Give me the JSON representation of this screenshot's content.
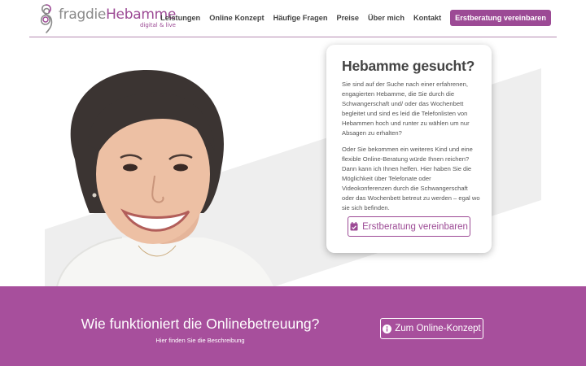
{
  "brand": {
    "name_light": "fragdie",
    "name_strong": "Hebamme",
    "tagline": "digital & live",
    "accent": "#9c4a95"
  },
  "nav": {
    "items": [
      {
        "label": "Leistungen"
      },
      {
        "label": "Online Konzept"
      },
      {
        "label": "Häufige Fragen"
      },
      {
        "label": "Preise"
      },
      {
        "label": "Über mich"
      },
      {
        "label": "Kontakt"
      }
    ],
    "cta_label": "Erstberatung vereinbaren"
  },
  "hero": {
    "title": "Hebamme gesucht?",
    "paragraph_1": "Sie sind auf der Suche nach einer erfahrenen, engagierten Hebamme, die Sie durch die Schwangerschaft und/ oder das Wochenbett begleitet und sind es leid die Telefonlisten von Hebammen hoch und runter zu wählen um nur Absagen zu erhalten?",
    "paragraph_2": "Oder Sie bekommen ein weiteres Kind und eine flexible Online-Beratung würde Ihnen reichen? Dann kann ich Ihnen helfen. Hier haben Sie die Möglichkeit über Telefonate oder Videokonferenzen durch die Schwangerschaft oder das Wochenbett betreut zu werden – egal wo sie sich befinden.",
    "button_label": "Erstberatung vereinbaren",
    "button_icon": "calendar-check-icon"
  },
  "band": {
    "title": "Wie funktioniert die Onlinebetreuung?",
    "subtitle": "Hier finden Sie die Beschreibung",
    "button_label": "Zum Online-Konzept",
    "button_icon": "info-circle-icon",
    "color": "#a74f9c"
  }
}
